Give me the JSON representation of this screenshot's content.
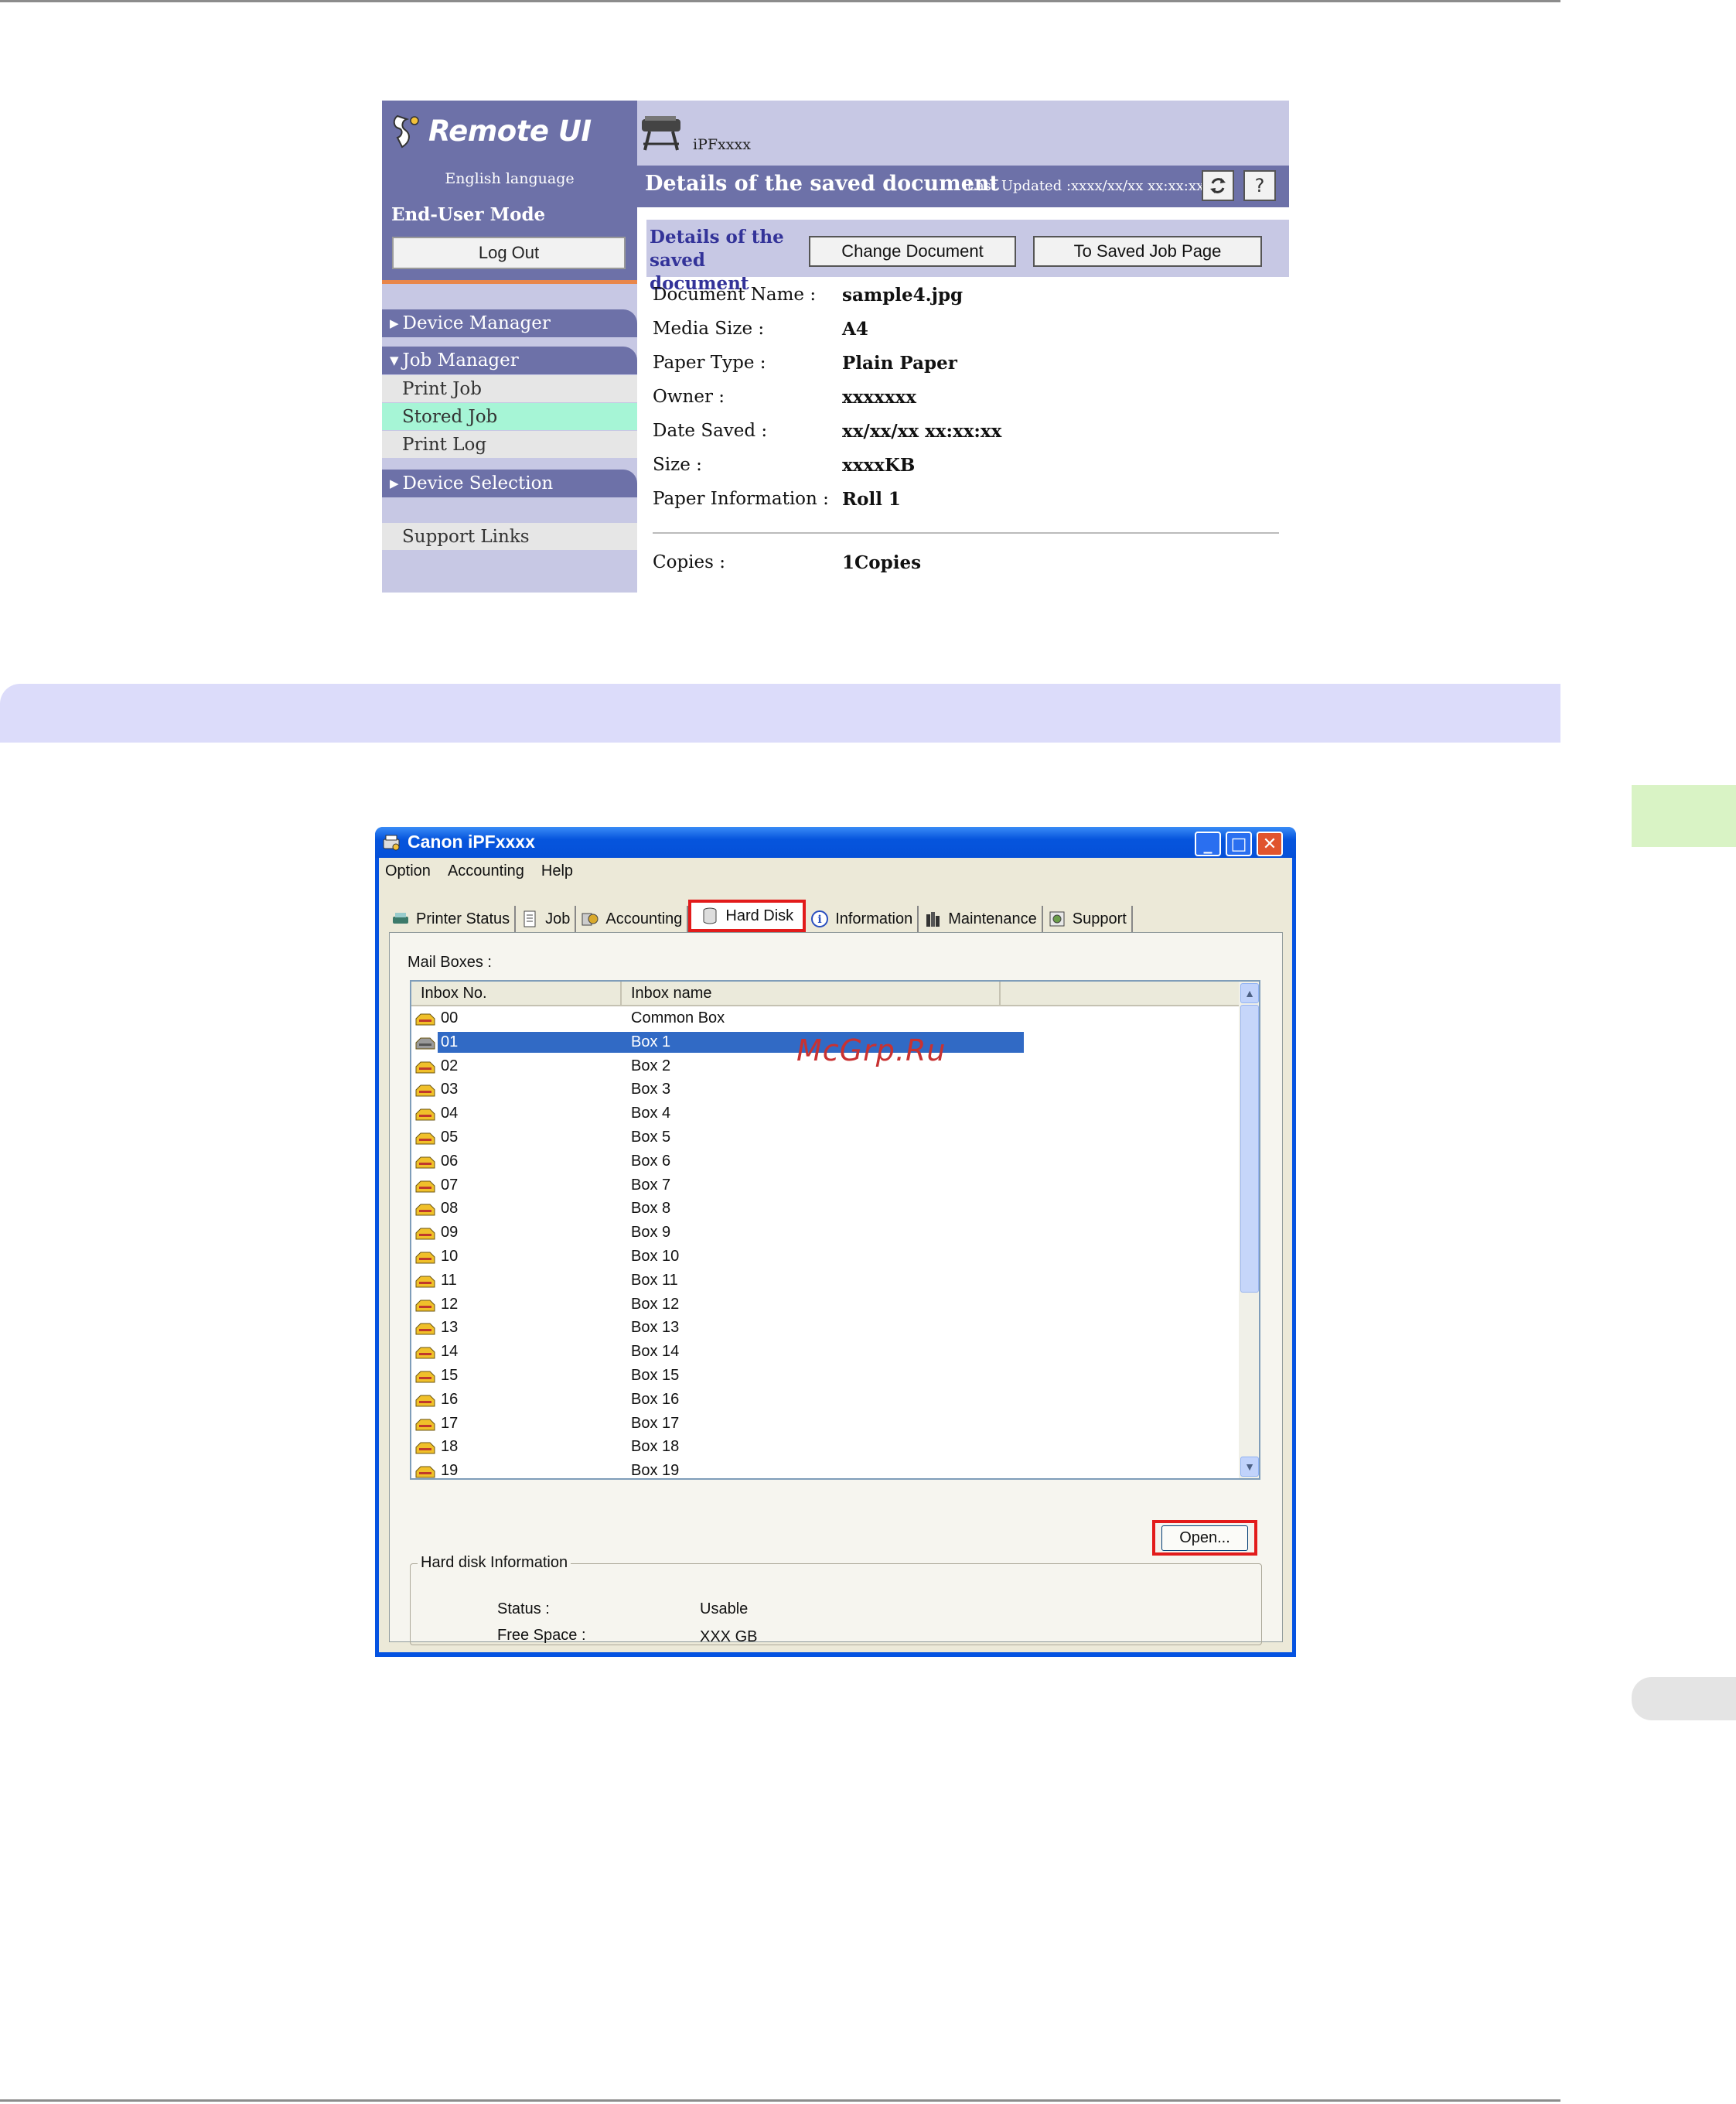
{
  "remote_ui": {
    "logo_text": "Remote UI",
    "language": "English language",
    "mode": "End-User Mode",
    "logout_label": "Log Out",
    "nav": {
      "device_manager": "Device Manager",
      "job_manager": "Job Manager",
      "print_job": "Print Job",
      "stored_job": "Stored Job",
      "print_log": "Print Log",
      "device_selection": "Device Selection",
      "support_links": "Support Links"
    },
    "model": "iPFxxxx",
    "page_title": "Details of the saved document",
    "last_updated": "Last Updated :xxxx/xx/xx xx:xx:xx",
    "refresh_icon": "refresh-icon",
    "help_label": "?",
    "section_title_line1": "Details of the",
    "section_title_line2": "saved document",
    "change_document_label": "Change Document",
    "to_saved_job_label": "To Saved Job Page",
    "details": [
      {
        "label": "Document Name :",
        "value": "sample4.jpg"
      },
      {
        "label": "Media Size :",
        "value": "A4"
      },
      {
        "label": "Paper Type :",
        "value": "Plain Paper"
      },
      {
        "label": "Owner :",
        "value": "xxxxxxx"
      },
      {
        "label": "Date Saved :",
        "value": "xx/xx/xx xx:xx:xx"
      },
      {
        "label": "Size :",
        "value": "xxxxKB"
      },
      {
        "label": "Paper Information :",
        "value": "Roll 1"
      }
    ],
    "copies": {
      "label": "Copies :",
      "value": "1Copies"
    }
  },
  "dialog": {
    "title": "Canon iPFxxxx",
    "menu": [
      "Option",
      "Accounting",
      "Help"
    ],
    "tabs": [
      {
        "label": "Printer Status",
        "icon": "printer-icon"
      },
      {
        "label": "Job",
        "icon": "document-icon"
      },
      {
        "label": "Accounting",
        "icon": "accounting-icon"
      },
      {
        "label": "Hard Disk",
        "icon": "hard-disk-icon",
        "active": true
      },
      {
        "label": "Information",
        "icon": "info-icon"
      },
      {
        "label": "Maintenance",
        "icon": "maintenance-icon"
      },
      {
        "label": "Support",
        "icon": "support-icon"
      }
    ],
    "mailboxes_label": "Mail Boxes :",
    "columns": [
      "Inbox No.",
      "Inbox name"
    ],
    "rows": [
      {
        "no": "00",
        "name": "Common Box"
      },
      {
        "no": "01",
        "name": "Box 1",
        "selected": true
      },
      {
        "no": "02",
        "name": "Box 2"
      },
      {
        "no": "03",
        "name": "Box 3"
      },
      {
        "no": "04",
        "name": "Box 4"
      },
      {
        "no": "05",
        "name": "Box 5"
      },
      {
        "no": "06",
        "name": "Box 6"
      },
      {
        "no": "07",
        "name": "Box 7"
      },
      {
        "no": "08",
        "name": "Box 8"
      },
      {
        "no": "09",
        "name": "Box 9"
      },
      {
        "no": "10",
        "name": "Box 10"
      },
      {
        "no": "11",
        "name": "Box 11"
      },
      {
        "no": "12",
        "name": "Box 12"
      },
      {
        "no": "13",
        "name": "Box 13"
      },
      {
        "no": "14",
        "name": "Box 14"
      },
      {
        "no": "15",
        "name": "Box 15"
      },
      {
        "no": "16",
        "name": "Box 16"
      },
      {
        "no": "17",
        "name": "Box 17"
      },
      {
        "no": "18",
        "name": "Box 18"
      },
      {
        "no": "19",
        "name": "Box 19"
      }
    ],
    "open_label": "Open...",
    "hd_info": {
      "title": "Hard disk Information",
      "status_label": "Status :",
      "status_value": "Usable",
      "free_label": "Free Space :",
      "free_value": "XXX GB"
    }
  },
  "watermark": "McGrp.Ru",
  "colors": {
    "remote_ui_header": "#6d71a8",
    "remote_ui_light": "#c7c8e4",
    "selected_nav": "#a6f5d6",
    "highlight_box": "#e21b1b",
    "xp_blue": "#0553e1",
    "selection": "#316ac5"
  }
}
